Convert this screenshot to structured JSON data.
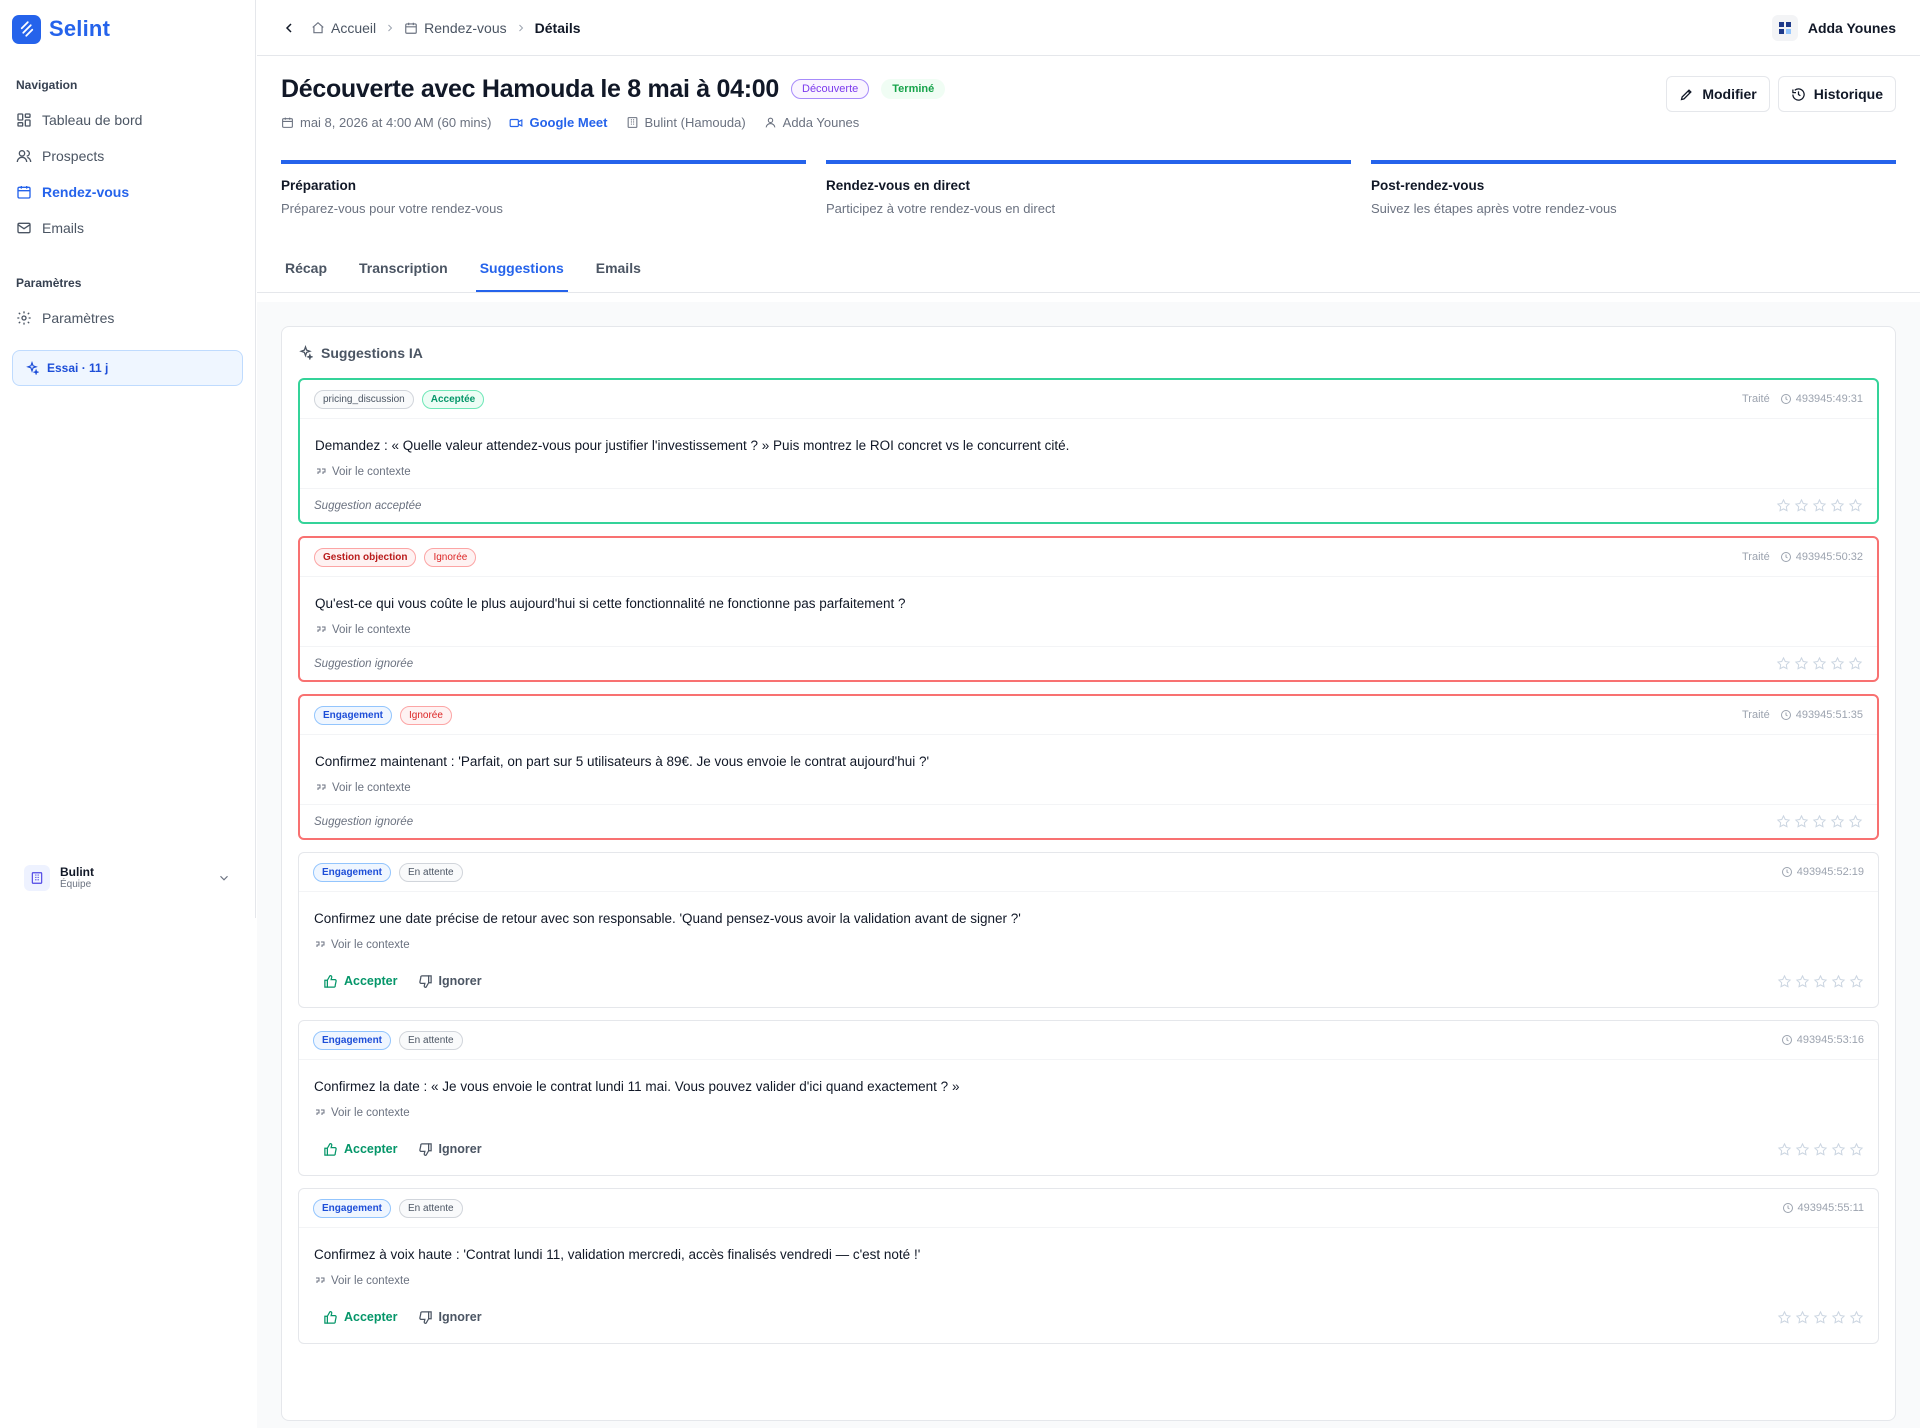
{
  "app": {
    "name": "Selint"
  },
  "sidebar": {
    "nav_heading": "Navigation",
    "nav_items": [
      {
        "label": "Tableau de bord",
        "icon": "dashboard-icon"
      },
      {
        "label": "Prospects",
        "icon": "users-icon"
      },
      {
        "label": "Rendez-vous",
        "icon": "calendar-icon",
        "active": true
      },
      {
        "label": "Emails",
        "icon": "mail-icon"
      }
    ],
    "settings_heading": "Paramètres",
    "settings_items": [
      {
        "label": "Paramètres",
        "icon": "gear-icon"
      }
    ],
    "trial_label": "Essai · 11 j",
    "team": {
      "name": "Bulint",
      "subtitle": "Équipe"
    }
  },
  "topbar": {
    "breadcrumbs": [
      {
        "label": "Accueil",
        "icon": "home-icon"
      },
      {
        "label": "Rendez-vous",
        "icon": "calendar-icon"
      },
      {
        "label": "Détails"
      }
    ],
    "user_name": "Adda Younes"
  },
  "header": {
    "title": "Découverte avec Hamouda le 8 mai à 04:00",
    "type_badge": "Découverte",
    "status_badge": "Terminé",
    "date": "mai 8, 2026 at 4:00 AM (60 mins)",
    "platform": "Google Meet",
    "company": "Bulint (Hamouda)",
    "owner": "Adda Younes",
    "edit_label": "Modifier",
    "history_label": "Historique"
  },
  "steps": [
    {
      "title": "Préparation",
      "subtitle": "Préparez-vous pour votre rendez-vous"
    },
    {
      "title": "Rendez-vous en direct",
      "subtitle": "Participez à votre rendez-vous en direct"
    },
    {
      "title": "Post-rendez-vous",
      "subtitle": "Suivez les étapes après votre rendez-vous"
    }
  ],
  "tabs": [
    {
      "label": "Récap"
    },
    {
      "label": "Transcription"
    },
    {
      "label": "Suggestions",
      "active": true
    },
    {
      "label": "Emails"
    }
  ],
  "suggestions_panel": {
    "title": "Suggestions IA",
    "context_label": "Voir le contexte",
    "accept_label": "Accepter",
    "ignore_label": "Ignorer",
    "processed_label": "Traité",
    "items": [
      {
        "category": "pricing_discussion",
        "status": "Acceptée",
        "state": "accepted",
        "time": "493945:49:31",
        "text": "Demandez : « Quelle valeur attendez-vous pour justifier l'investissement ? » Puis montrez le ROI concret vs le concurrent cité.",
        "footer": "Suggestion acceptée"
      },
      {
        "category": "Gestion objection",
        "status": "Ignorée",
        "state": "ignored",
        "time": "493945:50:32",
        "text": "Qu'est-ce qui vous coûte le plus aujourd'hui si cette fonctionnalité ne fonctionne pas parfaitement ?",
        "footer": "Suggestion ignorée"
      },
      {
        "category": "Engagement",
        "status": "Ignorée",
        "state": "ignored",
        "time": "493945:51:35",
        "text": "Confirmez maintenant : 'Parfait, on part sur 5 utilisateurs à 89€. Je vous envoie le contrat aujourd'hui ?'",
        "footer": "Suggestion ignorée"
      },
      {
        "category": "Engagement",
        "status": "En attente",
        "state": "pending",
        "time": "493945:52:19",
        "text": "Confirmez une date précise de retour avec son responsable. 'Quand pensez-vous avoir la validation avant de signer ?'"
      },
      {
        "category": "Engagement",
        "status": "En attente",
        "state": "pending",
        "time": "493945:53:16",
        "text": "Confirmez la date : « Je vous envoie le contrat lundi 11 mai. Vous pouvez valider d'ici quand exactement ? »"
      },
      {
        "category": "Engagement",
        "status": "En attente",
        "state": "pending",
        "time": "493945:55:11",
        "text": "Confirmez à voix haute : 'Contrat lundi 11, validation mercredi, accès finalisés vendredi — c'est noté !'"
      }
    ]
  }
}
